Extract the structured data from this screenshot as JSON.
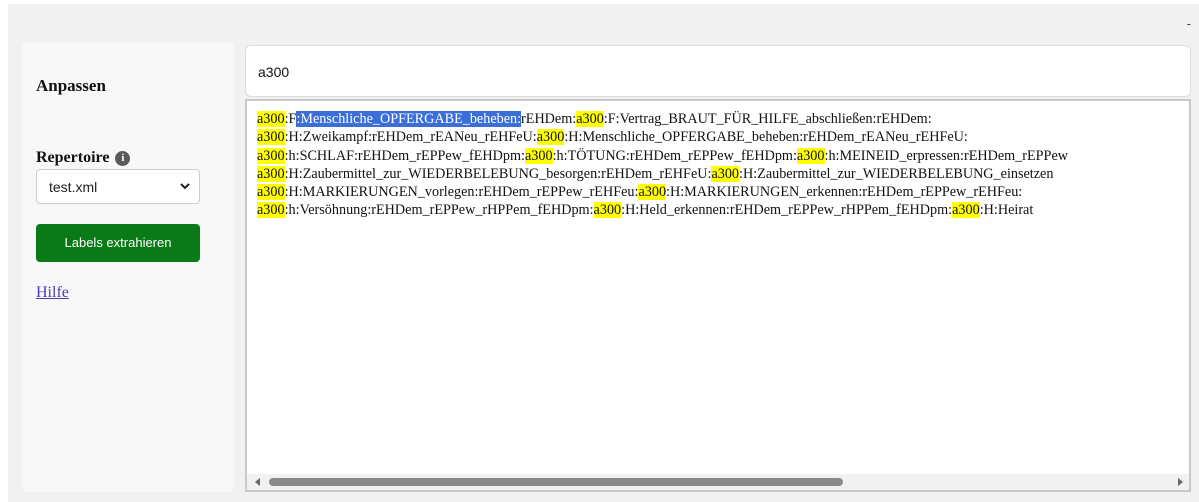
{
  "topbar": {
    "menu_glyph": "-"
  },
  "sidebar": {
    "heading": "Anpassen",
    "repertoire_label": "Repertoire",
    "info_glyph": "i",
    "select_value": "test.xml",
    "button_label": "Labels extrahieren",
    "help_link": "Hilfe"
  },
  "search": {
    "value": "a300"
  },
  "output": {
    "lines": [
      [
        {
          "t": "a300",
          "c": "hl"
        },
        {
          "t": ":F",
          "c": ""
        },
        {
          "t": ":Menschliche_OPFERGABE_beheben:",
          "c": "sel"
        },
        {
          "t": "rEHDem:",
          "c": ""
        },
        {
          "t": "a300",
          "c": "hl"
        },
        {
          "t": ":F:Vertrag_BRAUT_FÜR_HILFE_abschließen:rEHDem:",
          "c": ""
        }
      ],
      [
        {
          "t": "a300",
          "c": "hl"
        },
        {
          "t": ":H:Zweikampf:rEHDem_rEANeu_rEHFeU:",
          "c": ""
        },
        {
          "t": "a300",
          "c": "hl"
        },
        {
          "t": ":H:Menschliche_OPFERGABE_beheben:rEHDem_rEANeu_rEHFeU:",
          "c": ""
        }
      ],
      [
        {
          "t": "a300",
          "c": "hl"
        },
        {
          "t": ":h:SCHLAF:rEHDem_rEPPew_fEHDpm:",
          "c": ""
        },
        {
          "t": "a300",
          "c": "hl"
        },
        {
          "t": ":h:TÖTUNG:rEHDem_rEPPew_fEHDpm:",
          "c": ""
        },
        {
          "t": "a300",
          "c": "hl"
        },
        {
          "t": ":h:MEINEID_erpressen:rEHDem_rEPPew",
          "c": ""
        }
      ],
      [
        {
          "t": "a300",
          "c": "hl"
        },
        {
          "t": ":H:Zaubermittel_zur_WIEDERBELEBUNG_besorgen:rEHDem_rEHFeU:",
          "c": ""
        },
        {
          "t": "a300",
          "c": "hl"
        },
        {
          "t": ":H:Zaubermittel_zur_WIEDERBELEBUNG_einsetzen",
          "c": ""
        }
      ],
      [
        {
          "t": "a300",
          "c": "hl"
        },
        {
          "t": ":H:MARKIERUNGEN_vorlegen:rEHDem_rEPPew_rEHFeu:",
          "c": ""
        },
        {
          "t": "a300",
          "c": "hl"
        },
        {
          "t": ":H:MARKIERUNGEN_erkennen:rEHDem_rEPPew_rEHFeu:",
          "c": ""
        }
      ],
      [
        {
          "t": "a300",
          "c": "hl"
        },
        {
          "t": ":h:Versöhnung:rEHDem_rEPPew_rHPPem_fEHDpm:",
          "c": ""
        },
        {
          "t": "a300",
          "c": "hl"
        },
        {
          "t": ":H:Held_erkennen:rEHDem_rEPPew_rHPPem_fEHDpm:",
          "c": ""
        },
        {
          "t": "a300",
          "c": "hl"
        },
        {
          "t": ":H:Heirat",
          "c": ""
        }
      ]
    ]
  },
  "colors": {
    "button": "#0a7a18",
    "highlight": "#ffff00",
    "selection": "#3a6fd8",
    "link": "#4b3ab0"
  }
}
